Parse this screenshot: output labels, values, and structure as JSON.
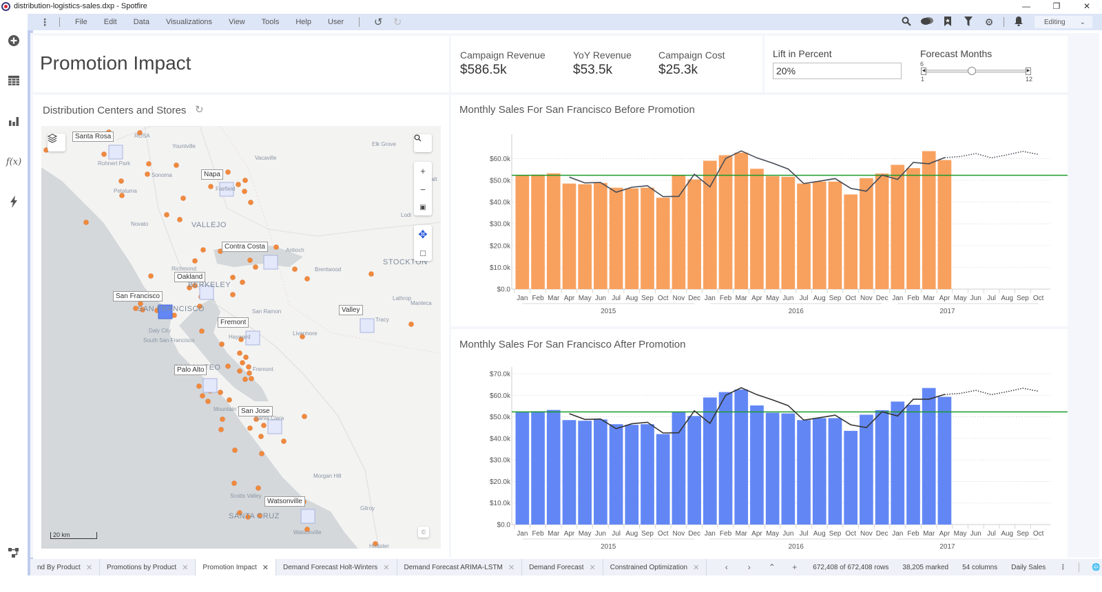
{
  "window": {
    "title": "distribution-logistics-sales.dxp - Spotfire",
    "controls": [
      "minimize",
      "restore",
      "close"
    ]
  },
  "menubar": {
    "items": [
      "File",
      "Edit",
      "Data",
      "Visualizations",
      "View",
      "Tools",
      "Help",
      "User"
    ],
    "right_icons": [
      "search-icon",
      "collaboration-icon",
      "bookmark-icon",
      "filter-icon",
      "settings-icon",
      "notification-icon"
    ],
    "mode": "Editing"
  },
  "sidebar": {
    "icons": [
      "add-icon",
      "data-table-icon",
      "visualization-icon",
      "expression-icon",
      "lightning-icon"
    ],
    "bottom_icon": "data-canvas-icon"
  },
  "page": {
    "title": "Promotion Impact"
  },
  "kpis": [
    {
      "label": "Campaign Revenue",
      "value": "$586.5k"
    },
    {
      "label": "YoY Revenue",
      "value": "$53.5k"
    },
    {
      "label": "Campaign Cost",
      "value": "$25.3k"
    }
  ],
  "controls": {
    "lift": {
      "label": "Lift in Percent",
      "value": "20%"
    },
    "forecast_months": {
      "label": "Forecast Months",
      "value": 6,
      "min": 1,
      "max": 12,
      "value_label": "6",
      "min_label": "1",
      "max_label": "12"
    }
  },
  "map": {
    "title": "Distribution Centers and Stores",
    "scale_label": "20 km",
    "attribution": "©",
    "selected_center": "San Francisco",
    "center_labels": [
      "Santa Rosa",
      "Napa",
      "Contra Costa",
      "Oakland",
      "San Francisco",
      "Fremont",
      "Valley",
      "Palo Alto",
      "San Jose",
      "Watsonville"
    ],
    "place_names": [
      "ROSA",
      "Yountville",
      "Vacaville",
      "Elk Grove",
      "Rohnert Park",
      "Sonoma",
      "Fairfield",
      "Petaluma",
      "Galt",
      "Novato",
      "VALLEJO",
      "Lodi",
      "Antioch",
      "STOCKTON",
      "Richmond",
      "Brentwood",
      "BERKELEY",
      "SAN FRANCISCO",
      "San Ramon",
      "Lathrop",
      "Manteca",
      "Tracy",
      "Daly City",
      "Hayward",
      "Livermore",
      "South San Francisco",
      "SAN MATEO",
      "Fremont",
      "Mountain View",
      "Santa Clara",
      "Morgan Hill",
      "Scotts Valley",
      "Gilroy",
      "SANTA CRUZ",
      "Watsonville",
      "Hollister"
    ]
  },
  "tabs": [
    {
      "label": "nd By Product",
      "active": false
    },
    {
      "label": "Promotions by Product",
      "active": false
    },
    {
      "label": "Promotion Impact",
      "active": true
    },
    {
      "label": "Demand Forecast Holt-Winters",
      "active": false
    },
    {
      "label": "Demand Forecast ARIMA-LSTM",
      "active": false
    },
    {
      "label": "Demand Forecast",
      "active": false
    },
    {
      "label": "Constrained Optimization",
      "active": false
    }
  ],
  "status": {
    "rows": "672,408 of 672,408 rows",
    "marked": "38,205 marked",
    "columns": "54 columns",
    "table": "Daily Sales"
  },
  "colors": {
    "accent_before": "#f8a15f",
    "accent_after": "#6287f5",
    "reference_line": "#1a9a2a",
    "trend_line": "#444a55",
    "selected_center": "#6287f5",
    "center": "#e4e8fb",
    "store": "#f08a3c"
  },
  "chart_data": [
    {
      "type": "bar",
      "title": "Monthly Sales For San Francisco Before Promotion",
      "xlabel": "",
      "ylabel": "",
      "categories": [
        "Jan",
        "Feb",
        "Mar",
        "Apr",
        "May",
        "Jun",
        "Jul",
        "Aug",
        "Sep",
        "Oct",
        "Nov",
        "Dec",
        "Jan",
        "Feb",
        "Mar",
        "Apr",
        "May",
        "Jun",
        "Jul",
        "Aug",
        "Sep",
        "Oct",
        "Nov",
        "Dec",
        "Jan",
        "Feb",
        "Mar",
        "Apr",
        "May",
        "Jun",
        "Jul",
        "Aug",
        "Sep",
        "Oct"
      ],
      "year_groups": [
        {
          "label": "2015",
          "start": 0,
          "end": 11
        },
        {
          "label": "2016",
          "start": 12,
          "end": 23
        },
        {
          "label": "2017",
          "start": 24,
          "end": 33
        }
      ],
      "series": [
        {
          "name": "Sales",
          "kind": "bar",
          "color": "#f8a15f",
          "values": [
            52.3,
            52.6,
            53.2,
            48.5,
            48.2,
            48.8,
            46.6,
            46.3,
            46.6,
            42.0,
            52.2,
            50.4,
            59.0,
            61.5,
            62.7,
            55.3,
            51.9,
            51.6,
            48.5,
            49.4,
            49.4,
            43.5,
            51.0,
            53.1,
            57.1,
            55.6,
            63.4,
            59.3,
            null,
            null,
            null,
            null,
            null,
            null
          ]
        },
        {
          "name": "Trend",
          "kind": "line",
          "color": "#444a55",
          "values": [
            null,
            null,
            null,
            51.5,
            48.8,
            49.0,
            44.5,
            46.8,
            47.5,
            42.5,
            42.6,
            52.8,
            47.0,
            60.0,
            63.5,
            60.3,
            57.9,
            55.2,
            48.5,
            49.6,
            50.8,
            46.3,
            45.0,
            52.4,
            50.4,
            58.2,
            57.6,
            60.4,
            null,
            null,
            null,
            null,
            null,
            null
          ]
        },
        {
          "name": "Forecast",
          "kind": "dotted-line",
          "color": "#444a55",
          "values": [
            null,
            null,
            null,
            null,
            null,
            null,
            null,
            null,
            null,
            null,
            null,
            null,
            null,
            null,
            null,
            null,
            null,
            null,
            null,
            null,
            null,
            null,
            null,
            null,
            null,
            null,
            null,
            60.4,
            60.9,
            62.3,
            60.3,
            61.7,
            63.3,
            61.9
          ]
        }
      ],
      "reference_line": {
        "value": 52.3,
        "color": "#1a9a2a"
      },
      "unit": "$k",
      "yticks": [
        "$0.0",
        "$10.0k",
        "$20.0k",
        "$30.0k",
        "$40.0k",
        "$50.0k",
        "$60.0k"
      ],
      "ylim": [
        0,
        68
      ],
      "grid": true,
      "legend": "none"
    },
    {
      "type": "bar",
      "title": "Monthly Sales For San Francisco After Promotion",
      "xlabel": "",
      "ylabel": "",
      "categories": [
        "Jan",
        "Feb",
        "Mar",
        "Apr",
        "May",
        "Jun",
        "Jul",
        "Aug",
        "Sep",
        "Oct",
        "Nov",
        "Dec",
        "Jan",
        "Feb",
        "Mar",
        "Apr",
        "May",
        "Jun",
        "Jul",
        "Aug",
        "Sep",
        "Oct",
        "Nov",
        "Dec",
        "Jan",
        "Feb",
        "Mar",
        "Apr",
        "May",
        "Jun",
        "Jul",
        "Aug",
        "Sep",
        "Oct"
      ],
      "year_groups": [
        {
          "label": "2015",
          "start": 0,
          "end": 11
        },
        {
          "label": "2016",
          "start": 12,
          "end": 23
        },
        {
          "label": "2017",
          "start": 24,
          "end": 33
        }
      ],
      "series": [
        {
          "name": "Sales",
          "kind": "bar",
          "color": "#6287f5",
          "values": [
            52.3,
            52.6,
            53.2,
            48.5,
            48.2,
            48.8,
            46.6,
            46.3,
            46.6,
            42.0,
            52.2,
            50.4,
            59.0,
            61.5,
            62.7,
            55.3,
            51.9,
            51.6,
            48.5,
            49.4,
            49.4,
            43.5,
            51.0,
            53.1,
            57.1,
            55.6,
            63.4,
            59.3,
            null,
            null,
            null,
            null,
            null,
            null
          ]
        },
        {
          "name": "Trend",
          "kind": "line",
          "color": "#333333",
          "values": [
            null,
            null,
            null,
            51.5,
            48.8,
            49.0,
            44.5,
            46.8,
            47.5,
            42.5,
            42.6,
            52.8,
            47.0,
            60.0,
            63.5,
            60.3,
            57.9,
            55.2,
            48.5,
            49.6,
            50.8,
            46.3,
            45.0,
            52.4,
            50.4,
            58.2,
            58.2,
            60.4,
            null,
            null,
            null,
            null,
            null,
            null
          ]
        },
        {
          "name": "Forecast",
          "kind": "dotted-line",
          "color": "#333333",
          "values": [
            null,
            null,
            null,
            null,
            null,
            null,
            null,
            null,
            null,
            null,
            null,
            null,
            null,
            null,
            null,
            null,
            null,
            null,
            null,
            null,
            null,
            null,
            null,
            null,
            null,
            null,
            null,
            60.4,
            60.9,
            62.3,
            60.3,
            61.7,
            63.3,
            61.9
          ]
        }
      ],
      "reference_line": {
        "value": 52.3,
        "color": "#1a9a2a"
      },
      "unit": "$k",
      "yticks": [
        "$0.0",
        "$10.0k",
        "$20.0k",
        "$30.0k",
        "$40.0k",
        "$50.0k",
        "$60.0k",
        "$70.0k"
      ],
      "ylim": [
        0,
        70
      ],
      "grid": true,
      "legend": "none"
    }
  ]
}
